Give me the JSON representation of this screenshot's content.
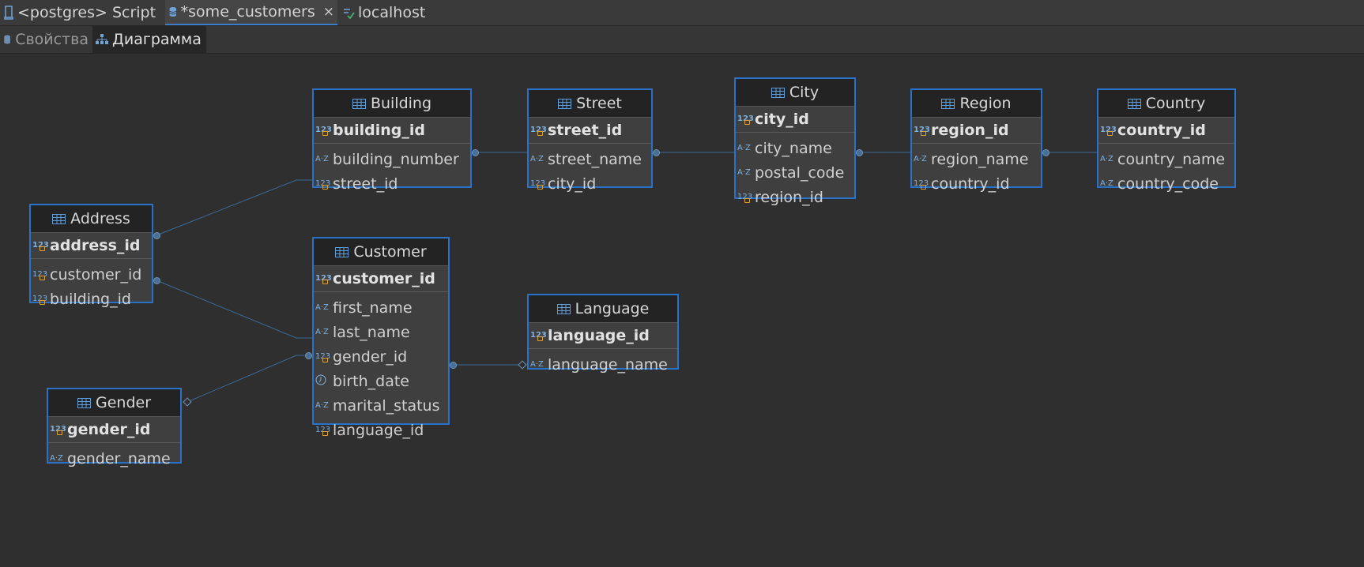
{
  "tabs": [
    {
      "label": "<postgres> Script",
      "active": false,
      "icon": "script-icon"
    },
    {
      "label": "*some_customers",
      "active": true,
      "icon": "database-icon",
      "close": "×"
    },
    {
      "label": "localhost",
      "active": false,
      "icon": "connection-icon"
    }
  ],
  "subtabs": [
    {
      "label": "Свойства",
      "active": false,
      "icon": "database-icon"
    },
    {
      "label": "Диаграмма",
      "active": true,
      "icon": "diagram-icon"
    }
  ],
  "entities": {
    "building": {
      "name": "Building",
      "pk": "building_id",
      "attrs": [
        "building_number",
        "street_id"
      ]
    },
    "street": {
      "name": "Street",
      "pk": "street_id",
      "attrs": [
        "street_name",
        "city_id"
      ]
    },
    "city": {
      "name": "City",
      "pk": "city_id",
      "attrs": [
        "city_name",
        "postal_code",
        "region_id"
      ]
    },
    "region": {
      "name": "Region",
      "pk": "region_id",
      "attrs": [
        "region_name",
        "country_id"
      ]
    },
    "country": {
      "name": "Country",
      "pk": "country_id",
      "attrs": [
        "country_name",
        "country_code"
      ]
    },
    "address": {
      "name": "Address",
      "pk": "address_id",
      "attrs": [
        "customer_id",
        "building_id"
      ]
    },
    "customer": {
      "name": "Customer",
      "pk": "customer_id",
      "attrs": [
        "first_name",
        "last_name",
        "gender_id",
        "birth_date",
        "marital_status",
        "language_id"
      ]
    },
    "language": {
      "name": "Language",
      "pk": "language_id",
      "attrs": [
        "language_name"
      ]
    },
    "gender": {
      "name": "Gender",
      "pk": "gender_id",
      "attrs": [
        "gender_name"
      ]
    }
  },
  "colors": {
    "accent": "#2a72c8",
    "background": "#2f2f2f",
    "header": "#232323",
    "line": "#3d6a96"
  }
}
